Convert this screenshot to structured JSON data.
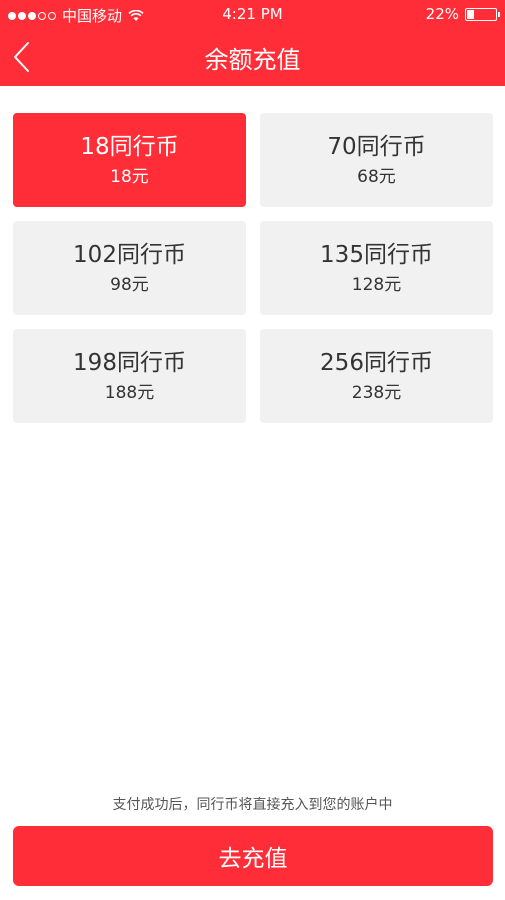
{
  "status_bar": {
    "carrier": "中国移动",
    "time": "4:21 PM",
    "battery": "22%",
    "battery_level": 0.22
  },
  "header": {
    "title": "余额充值",
    "back_icon": "chevron-left-icon"
  },
  "options": [
    {
      "coins": "18同行币",
      "price": "18元",
      "selected": true
    },
    {
      "coins": "70同行币",
      "price": "68元",
      "selected": false
    },
    {
      "coins": "102同行币",
      "price": "98元",
      "selected": false
    },
    {
      "coins": "135同行币",
      "price": "128元",
      "selected": false
    },
    {
      "coins": "198同行币",
      "price": "188元",
      "selected": false
    },
    {
      "coins": "256同行币",
      "price": "238元",
      "selected": false
    }
  ],
  "footer": {
    "note": "支付成功后，同行币将直接充入到您的账户中",
    "pay_button": "去充值"
  },
  "colors": {
    "accent": "#ff2d37",
    "card_bg": "#f1f1f1"
  }
}
